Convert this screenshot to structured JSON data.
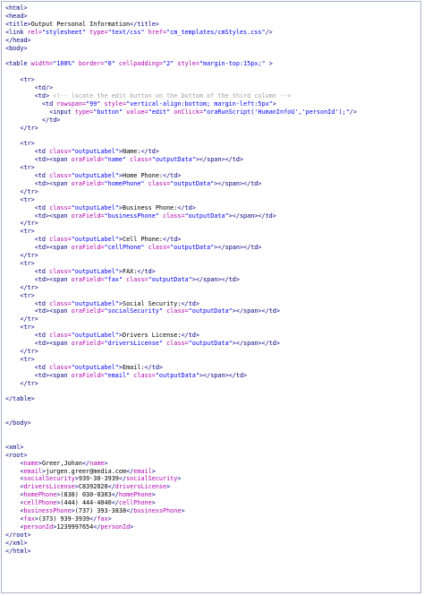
{
  "lines": [
    [
      [
        "t",
        "<html>"
      ]
    ],
    [
      [
        "t",
        "<head>"
      ]
    ],
    [
      [
        "t",
        "<title>"
      ],
      [
        "x",
        "Output Personal Information"
      ],
      [
        "t",
        "</title>"
      ]
    ],
    [
      [
        "t",
        "<link "
      ],
      [
        "a",
        "rel="
      ],
      [
        "v",
        "\"stylesheet\""
      ],
      [
        "x",
        " "
      ],
      [
        "a",
        "type="
      ],
      [
        "v",
        "\"text/css\""
      ],
      [
        "x",
        " "
      ],
      [
        "a",
        "href="
      ],
      [
        "v",
        "\"cm_templates/cmStyles.css\""
      ],
      [
        "t",
        "/>"
      ]
    ],
    [
      [
        "t",
        "</head>"
      ]
    ],
    [
      [
        "t",
        "<body>"
      ]
    ],
    [
      [
        "x",
        ""
      ]
    ],
    [
      [
        "t",
        "<table "
      ],
      [
        "a",
        "width="
      ],
      [
        "v",
        "\"100%\""
      ],
      [
        "x",
        " "
      ],
      [
        "a",
        "border="
      ],
      [
        "v",
        "\"0\""
      ],
      [
        "x",
        " "
      ],
      [
        "a",
        "cellpadding="
      ],
      [
        "v",
        "\"2\""
      ],
      [
        "x",
        " "
      ],
      [
        "a",
        "style="
      ],
      [
        "v",
        "\"margin-top:15px;\""
      ],
      [
        "t",
        " >"
      ]
    ],
    [
      [
        "x",
        ""
      ]
    ],
    [
      [
        "x",
        "    "
      ],
      [
        "t",
        "<tr>"
      ]
    ],
    [
      [
        "x",
        "        "
      ],
      [
        "t",
        "<td/>"
      ]
    ],
    [
      [
        "x",
        "        "
      ],
      [
        "t",
        "<td> "
      ],
      [
        "c",
        "<!-- locate the edit button on the bottom of the third column -->"
      ]
    ],
    [
      [
        "x",
        "          "
      ],
      [
        "t",
        "<td "
      ],
      [
        "a",
        "rowspan="
      ],
      [
        "v",
        "\"99\""
      ],
      [
        "x",
        " "
      ],
      [
        "a",
        "style="
      ],
      [
        "v",
        "\"vertical-align:bottom; margin-left:5px\""
      ],
      [
        "t",
        ">"
      ]
    ],
    [
      [
        "x",
        "            "
      ],
      [
        "t",
        "<input "
      ],
      [
        "a",
        "type="
      ],
      [
        "v",
        "\"button\""
      ],
      [
        "x",
        " "
      ],
      [
        "a",
        "value="
      ],
      [
        "v",
        "\"edit\""
      ],
      [
        "x",
        " "
      ],
      [
        "a",
        "onClick="
      ],
      [
        "v",
        "\"oraRunScript('HumanInfoU','personId');\""
      ],
      [
        "t",
        "/>"
      ]
    ],
    [
      [
        "x",
        "          "
      ],
      [
        "t",
        "</td>"
      ]
    ],
    [
      [
        "x",
        "    "
      ],
      [
        "t",
        "</tr>"
      ]
    ],
    [
      [
        "x",
        ""
      ]
    ],
    [
      [
        "x",
        "    "
      ],
      [
        "t",
        "<tr>"
      ]
    ],
    [
      [
        "x",
        "        "
      ],
      [
        "t",
        "<td "
      ],
      [
        "a",
        "class="
      ],
      [
        "v",
        "\"outputLabel\""
      ],
      [
        "t",
        ">"
      ],
      [
        "x",
        "Name:"
      ],
      [
        "t",
        "</td>"
      ]
    ],
    [
      [
        "x",
        "        "
      ],
      [
        "t",
        "<td><span "
      ],
      [
        "a",
        "oraField="
      ],
      [
        "v",
        "\"name\""
      ],
      [
        "x",
        " "
      ],
      [
        "a",
        "class="
      ],
      [
        "v",
        "\"outputData\""
      ],
      [
        "t",
        "></span></td>"
      ]
    ],
    [
      [
        "x",
        "    "
      ],
      [
        "t",
        "<tr>"
      ]
    ],
    [
      [
        "x",
        "        "
      ],
      [
        "t",
        "<td "
      ],
      [
        "a",
        "class="
      ],
      [
        "v",
        "\"outputLabel\""
      ],
      [
        "t",
        ">"
      ],
      [
        "x",
        "Home Phone:"
      ],
      [
        "t",
        "</td>"
      ]
    ],
    [
      [
        "x",
        "        "
      ],
      [
        "t",
        "<td><span "
      ],
      [
        "a",
        "oraField="
      ],
      [
        "v",
        "\"homePhone\""
      ],
      [
        "x",
        " "
      ],
      [
        "a",
        "class="
      ],
      [
        "v",
        "\"outputData\""
      ],
      [
        "t",
        "></span></td>"
      ]
    ],
    [
      [
        "x",
        "    "
      ],
      [
        "t",
        "</tr>"
      ]
    ],
    [
      [
        "x",
        "    "
      ],
      [
        "t",
        "<tr>"
      ]
    ],
    [
      [
        "x",
        "        "
      ],
      [
        "t",
        "<td "
      ],
      [
        "a",
        "class="
      ],
      [
        "v",
        "\"outputLabel\""
      ],
      [
        "t",
        ">"
      ],
      [
        "x",
        "Business Phone:"
      ],
      [
        "t",
        "</td>"
      ]
    ],
    [
      [
        "x",
        "        "
      ],
      [
        "t",
        "<td><span "
      ],
      [
        "a",
        "oraField="
      ],
      [
        "v",
        "\"businessPhone\""
      ],
      [
        "x",
        " "
      ],
      [
        "a",
        "class="
      ],
      [
        "v",
        "\"outputData\""
      ],
      [
        "t",
        "></span></td>"
      ]
    ],
    [
      [
        "x",
        "    "
      ],
      [
        "t",
        "</tr>"
      ]
    ],
    [
      [
        "x",
        "    "
      ],
      [
        "t",
        "<tr>"
      ]
    ],
    [
      [
        "x",
        "        "
      ],
      [
        "t",
        "<td "
      ],
      [
        "a",
        "class="
      ],
      [
        "v",
        "\"outputLabel\""
      ],
      [
        "t",
        ">"
      ],
      [
        "x",
        "Cell Phone:"
      ],
      [
        "t",
        "</td>"
      ]
    ],
    [
      [
        "x",
        "        "
      ],
      [
        "t",
        "<td><span "
      ],
      [
        "a",
        "oraField="
      ],
      [
        "v",
        "\"cellPhone\""
      ],
      [
        "x",
        " "
      ],
      [
        "a",
        "class="
      ],
      [
        "v",
        "\"outputData\""
      ],
      [
        "t",
        "></span></td>"
      ]
    ],
    [
      [
        "x",
        "    "
      ],
      [
        "t",
        "</tr>"
      ]
    ],
    [
      [
        "x",
        "    "
      ],
      [
        "t",
        "<tr>"
      ]
    ],
    [
      [
        "x",
        "        "
      ],
      [
        "t",
        "<td "
      ],
      [
        "a",
        "class="
      ],
      [
        "v",
        "\"outputLabel\""
      ],
      [
        "t",
        ">"
      ],
      [
        "x",
        "FAX:"
      ],
      [
        "t",
        "</td>"
      ]
    ],
    [
      [
        "x",
        "        "
      ],
      [
        "t",
        "<td><span "
      ],
      [
        "a",
        "oraField="
      ],
      [
        "v",
        "\"fax\""
      ],
      [
        "x",
        " "
      ],
      [
        "a",
        "class="
      ],
      [
        "v",
        "\"outputData\""
      ],
      [
        "t",
        "></span></td>"
      ]
    ],
    [
      [
        "x",
        "    "
      ],
      [
        "t",
        "</tr>"
      ]
    ],
    [
      [
        "x",
        "    "
      ],
      [
        "t",
        "<tr>"
      ]
    ],
    [
      [
        "x",
        "        "
      ],
      [
        "t",
        "<td "
      ],
      [
        "a",
        "class="
      ],
      [
        "v",
        "\"outputLabel\""
      ],
      [
        "t",
        ">"
      ],
      [
        "x",
        "Social Security:"
      ],
      [
        "t",
        "</td>"
      ]
    ],
    [
      [
        "x",
        "        "
      ],
      [
        "t",
        "<td><span "
      ],
      [
        "a",
        "oraField="
      ],
      [
        "v",
        "\"socialSecurity\""
      ],
      [
        "x",
        " "
      ],
      [
        "a",
        "class="
      ],
      [
        "v",
        "\"outputData\""
      ],
      [
        "t",
        "></span></td>"
      ]
    ],
    [
      [
        "x",
        "    "
      ],
      [
        "t",
        "</tr>"
      ]
    ],
    [
      [
        "x",
        "    "
      ],
      [
        "t",
        "<tr>"
      ]
    ],
    [
      [
        "x",
        "        "
      ],
      [
        "t",
        "<td "
      ],
      [
        "a",
        "class="
      ],
      [
        "v",
        "\"outputLabel\""
      ],
      [
        "t",
        ">"
      ],
      [
        "x",
        "Drivers License:"
      ],
      [
        "t",
        "</td>"
      ]
    ],
    [
      [
        "x",
        "        "
      ],
      [
        "t",
        "<td><span "
      ],
      [
        "a",
        "oraField="
      ],
      [
        "v",
        "\"driversLicense\""
      ],
      [
        "x",
        " "
      ],
      [
        "a",
        "class="
      ],
      [
        "v",
        "\"outputData\""
      ],
      [
        "t",
        "></span></td>"
      ]
    ],
    [
      [
        "x",
        "    "
      ],
      [
        "t",
        "</tr>"
      ]
    ],
    [
      [
        "x",
        "    "
      ],
      [
        "t",
        "<tr>"
      ]
    ],
    [
      [
        "x",
        "        "
      ],
      [
        "t",
        "<td "
      ],
      [
        "a",
        "class="
      ],
      [
        "v",
        "\"outputLabel\""
      ],
      [
        "t",
        ">"
      ],
      [
        "x",
        "Email:"
      ],
      [
        "t",
        "</td>"
      ]
    ],
    [
      [
        "x",
        "        "
      ],
      [
        "t",
        "<td><span "
      ],
      [
        "a",
        "oraField="
      ],
      [
        "v",
        "\"email\""
      ],
      [
        "x",
        " "
      ],
      [
        "a",
        "class="
      ],
      [
        "v",
        "\"outputData\""
      ],
      [
        "t",
        "></span></td>"
      ]
    ],
    [
      [
        "x",
        "    "
      ],
      [
        "t",
        "</tr>"
      ]
    ],
    [
      [
        "x",
        ""
      ]
    ],
    [
      [
        "t",
        "</table>"
      ]
    ],
    [
      [
        "x",
        ""
      ]
    ],
    [
      [
        "x",
        ""
      ]
    ],
    [
      [
        "t",
        "</body>"
      ]
    ],
    [
      [
        "x",
        ""
      ]
    ],
    [
      [
        "x",
        ""
      ]
    ],
    [
      [
        "t",
        "<xml>"
      ]
    ],
    [
      [
        "t",
        "<root>"
      ]
    ],
    [
      [
        "x",
        "    "
      ],
      [
        "t",
        "<"
      ],
      [
        "m",
        "name"
      ],
      [
        "t",
        ">"
      ],
      [
        "x",
        "Greer,Johan"
      ],
      [
        "t",
        "</"
      ],
      [
        "m",
        "name"
      ],
      [
        "t",
        ">"
      ]
    ],
    [
      [
        "x",
        "    "
      ],
      [
        "t",
        "<"
      ],
      [
        "m",
        "email"
      ],
      [
        "t",
        ">"
      ],
      [
        "x",
        "jurgen.greer@media.com"
      ],
      [
        "t",
        "</"
      ],
      [
        "m",
        "email"
      ],
      [
        "t",
        ">"
      ]
    ],
    [
      [
        "x",
        "    "
      ],
      [
        "t",
        "<"
      ],
      [
        "m",
        "socialSecurity"
      ],
      [
        "t",
        ">"
      ],
      [
        "x",
        "939-30-3939"
      ],
      [
        "t",
        "</"
      ],
      [
        "m",
        "socialSecurity"
      ],
      [
        "t",
        ">"
      ]
    ],
    [
      [
        "x",
        "    "
      ],
      [
        "t",
        "<"
      ],
      [
        "m",
        "driversLicense"
      ],
      [
        "t",
        ">"
      ],
      [
        "x",
        "C8392020"
      ],
      [
        "t",
        "</"
      ],
      [
        "m",
        "driversLicense"
      ],
      [
        "t",
        ">"
      ]
    ],
    [
      [
        "x",
        "    "
      ],
      [
        "t",
        "<"
      ],
      [
        "m",
        "homePhone"
      ],
      [
        "t",
        ">"
      ],
      [
        "x",
        "(838) 030-0303"
      ],
      [
        "t",
        "</"
      ],
      [
        "m",
        "homePhone"
      ],
      [
        "t",
        ">"
      ]
    ],
    [
      [
        "x",
        "    "
      ],
      [
        "t",
        "<"
      ],
      [
        "m",
        "cellPhone"
      ],
      [
        "t",
        ">"
      ],
      [
        "x",
        "(444) 444-4040"
      ],
      [
        "t",
        "</"
      ],
      [
        "m",
        "cellPhone"
      ],
      [
        "t",
        ">"
      ]
    ],
    [
      [
        "x",
        "    "
      ],
      [
        "t",
        "<"
      ],
      [
        "m",
        "businessPhone"
      ],
      [
        "t",
        ">"
      ],
      [
        "x",
        "(737) 393-3838"
      ],
      [
        "t",
        "</"
      ],
      [
        "m",
        "businessPhone"
      ],
      [
        "t",
        ">"
      ]
    ],
    [
      [
        "x",
        "    "
      ],
      [
        "t",
        "<"
      ],
      [
        "m",
        "fax"
      ],
      [
        "t",
        ">"
      ],
      [
        "x",
        "(373) 939-3939"
      ],
      [
        "t",
        "</"
      ],
      [
        "m",
        "fax"
      ],
      [
        "t",
        ">"
      ]
    ],
    [
      [
        "x",
        "    "
      ],
      [
        "t",
        "<"
      ],
      [
        "m",
        "personId"
      ],
      [
        "t",
        ">"
      ],
      [
        "x",
        "1239997654"
      ],
      [
        "t",
        "</"
      ],
      [
        "m",
        "personId"
      ],
      [
        "t",
        ">"
      ]
    ],
    [
      [
        "t",
        "</root>"
      ]
    ],
    [
      [
        "t",
        "</xml>"
      ]
    ],
    [
      [
        "t",
        "</html>"
      ]
    ]
  ],
  "colors": {
    "tag": "#000080",
    "attribute": "#b000b0",
    "value": "#0000ff",
    "comment": "#a0a0a0",
    "text": "#000000",
    "frame_border": "#a8b4c4"
  }
}
